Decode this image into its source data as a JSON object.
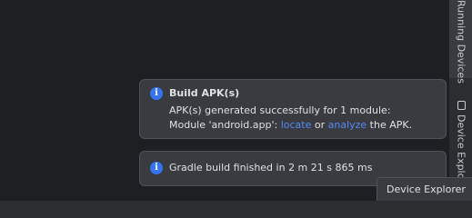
{
  "side_panel": {
    "running_devices_label": "Running Devices",
    "device_explorer_label": "Device Explorer"
  },
  "notifications": {
    "build": {
      "icon": "info-icon",
      "title": "Build APK(s)",
      "line1": "APK(s) generated successfully for 1 module:",
      "line2_prefix": "Module 'android.app': ",
      "locate_link": "locate",
      "line2_mid": " or ",
      "analyze_link": "analyze",
      "line2_suffix": " the APK."
    },
    "gradle": {
      "icon": "info-icon",
      "message": "Gradle build finished in 2 m 21 s 865 ms"
    }
  },
  "tooltip": {
    "text": "Device Explorer"
  },
  "colors": {
    "accent": "#3574f0",
    "link": "#548af7",
    "background": "#1e1f22",
    "panel": "#393b40"
  }
}
